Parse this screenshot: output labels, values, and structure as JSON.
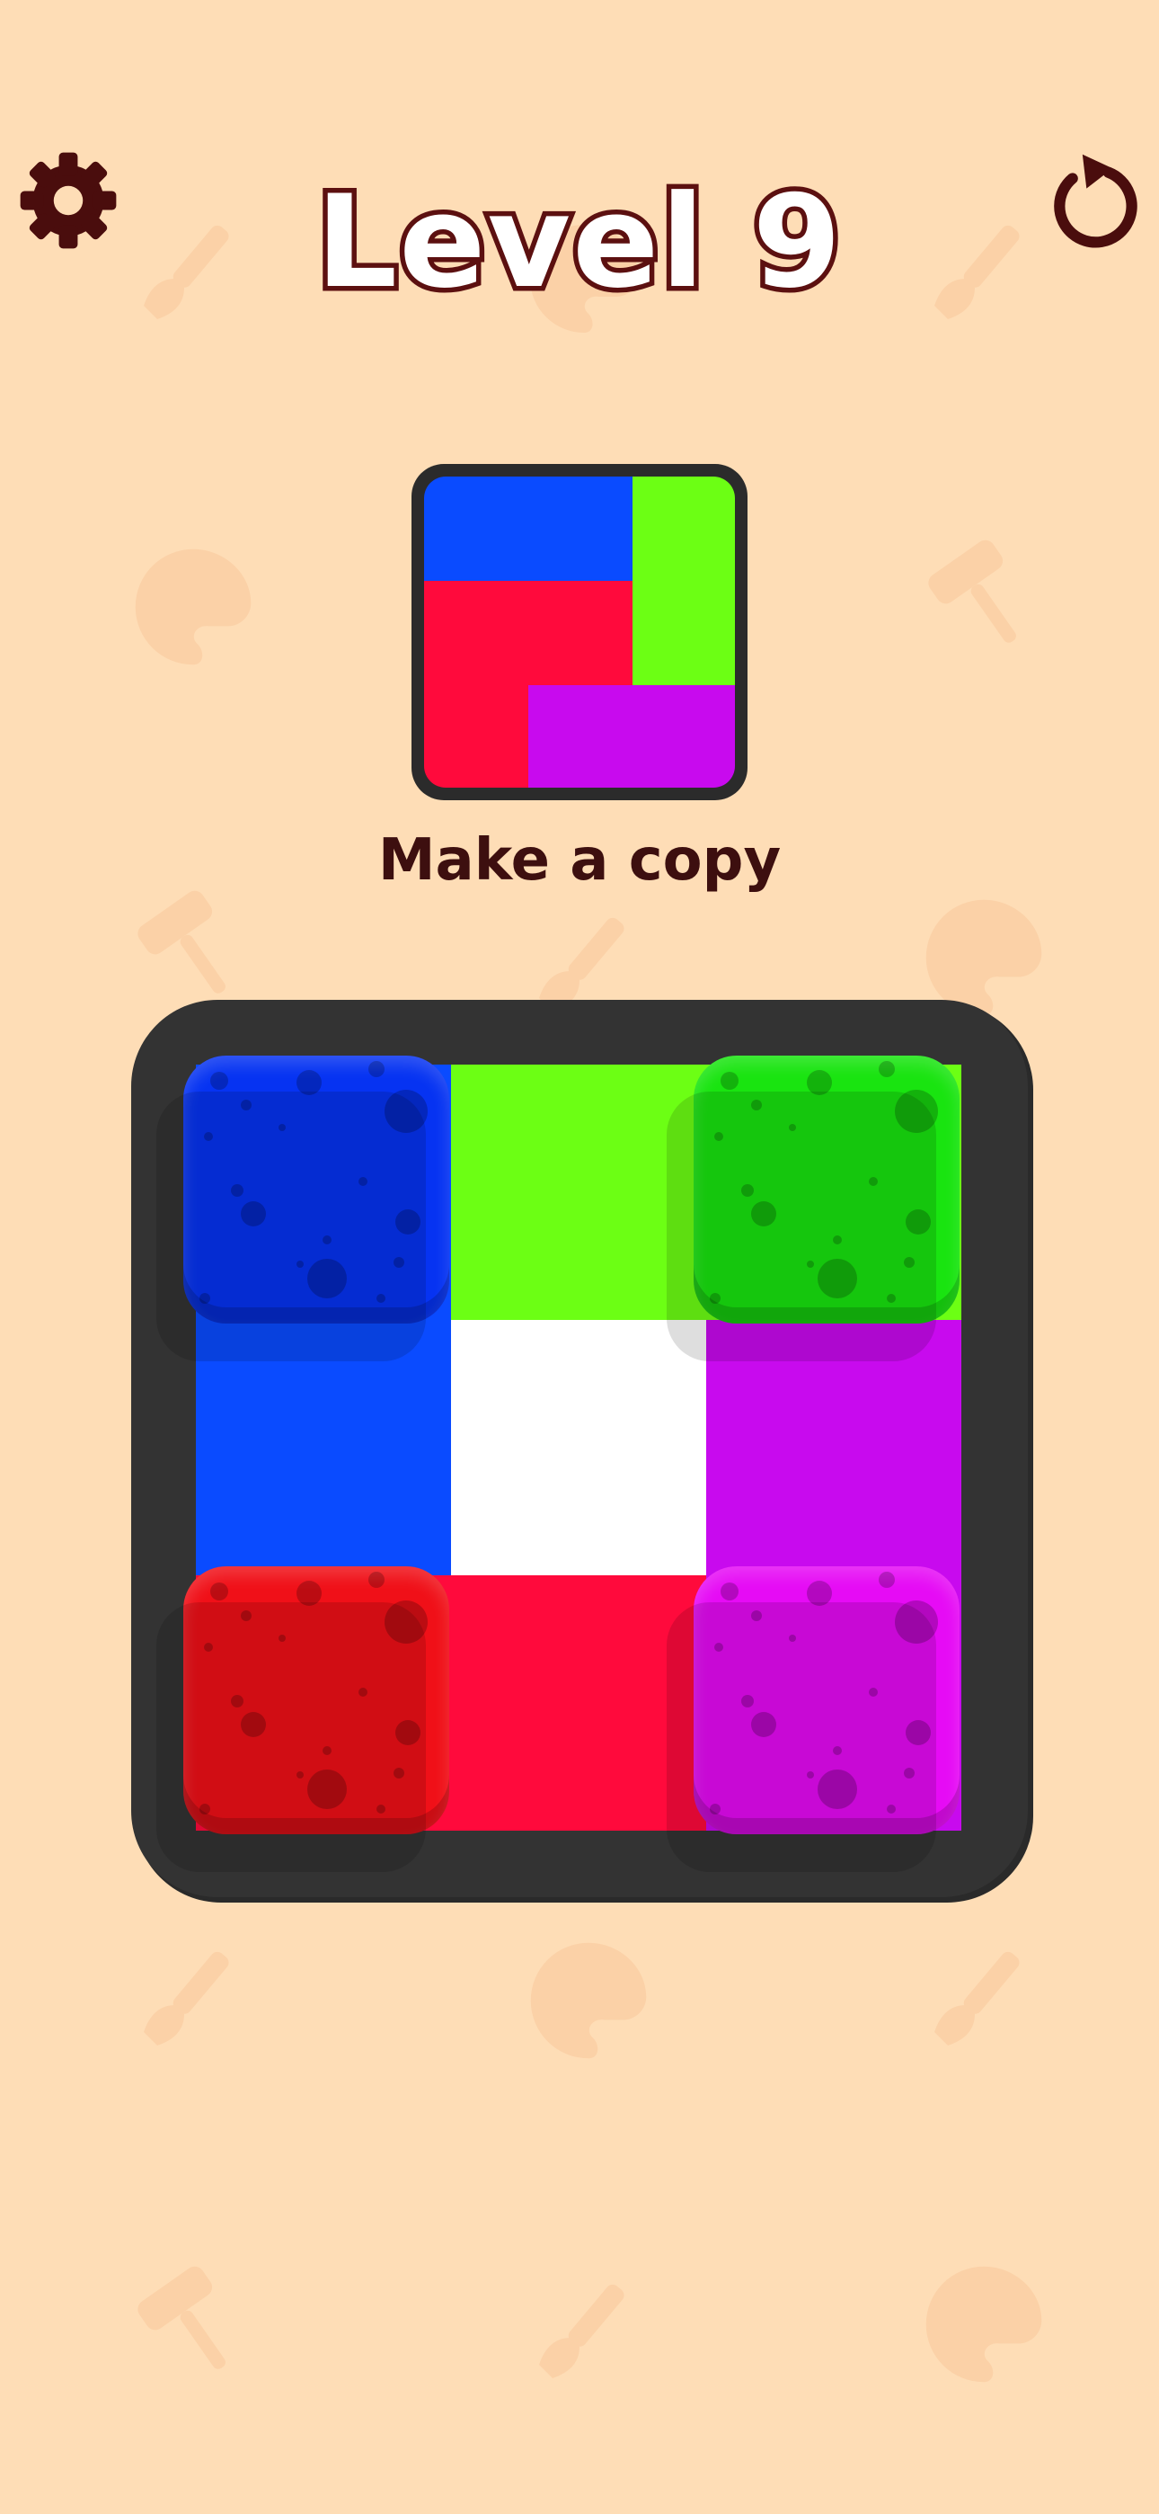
{
  "header": {
    "level_title": "Level 9"
  },
  "buttons": {
    "settings_icon": "gear-icon",
    "restart_icon": "restart-icon"
  },
  "target": {
    "instruction": "Make a copy",
    "regions": [
      {
        "name": "blue",
        "color": "#0A4BFF"
      },
      {
        "name": "green",
        "color": "#6CFF14"
      },
      {
        "name": "red",
        "color": "#FF0A3C"
      },
      {
        "name": "purple",
        "color": "#C80AEE"
      }
    ]
  },
  "board": {
    "rows": 3,
    "cols": 3,
    "cells": [
      [
        "blue",
        "green",
        "green"
      ],
      [
        "blue",
        "white",
        "purple"
      ],
      [
        "red",
        "red",
        "purple"
      ]
    ],
    "palette": {
      "blue": "#0A4BFF",
      "green": "#6CFF14",
      "white": "#FFFFFF",
      "purple": "#C80AEE",
      "red": "#FF0A3C"
    },
    "blocks": [
      {
        "name": "blue-block",
        "color": "#0633F2",
        "row": 0,
        "col": 0
      },
      {
        "name": "green-block",
        "color": "#19E410",
        "row": 0,
        "col": 2
      },
      {
        "name": "red-block",
        "color": "#F01018",
        "row": 2,
        "col": 0
      },
      {
        "name": "magenta-block",
        "color": "#E60BF5",
        "row": 2,
        "col": 2
      }
    ]
  },
  "colors": {
    "background": "#FEDDB6",
    "title_outline": "#5C1010",
    "board_frame": "#333333"
  }
}
